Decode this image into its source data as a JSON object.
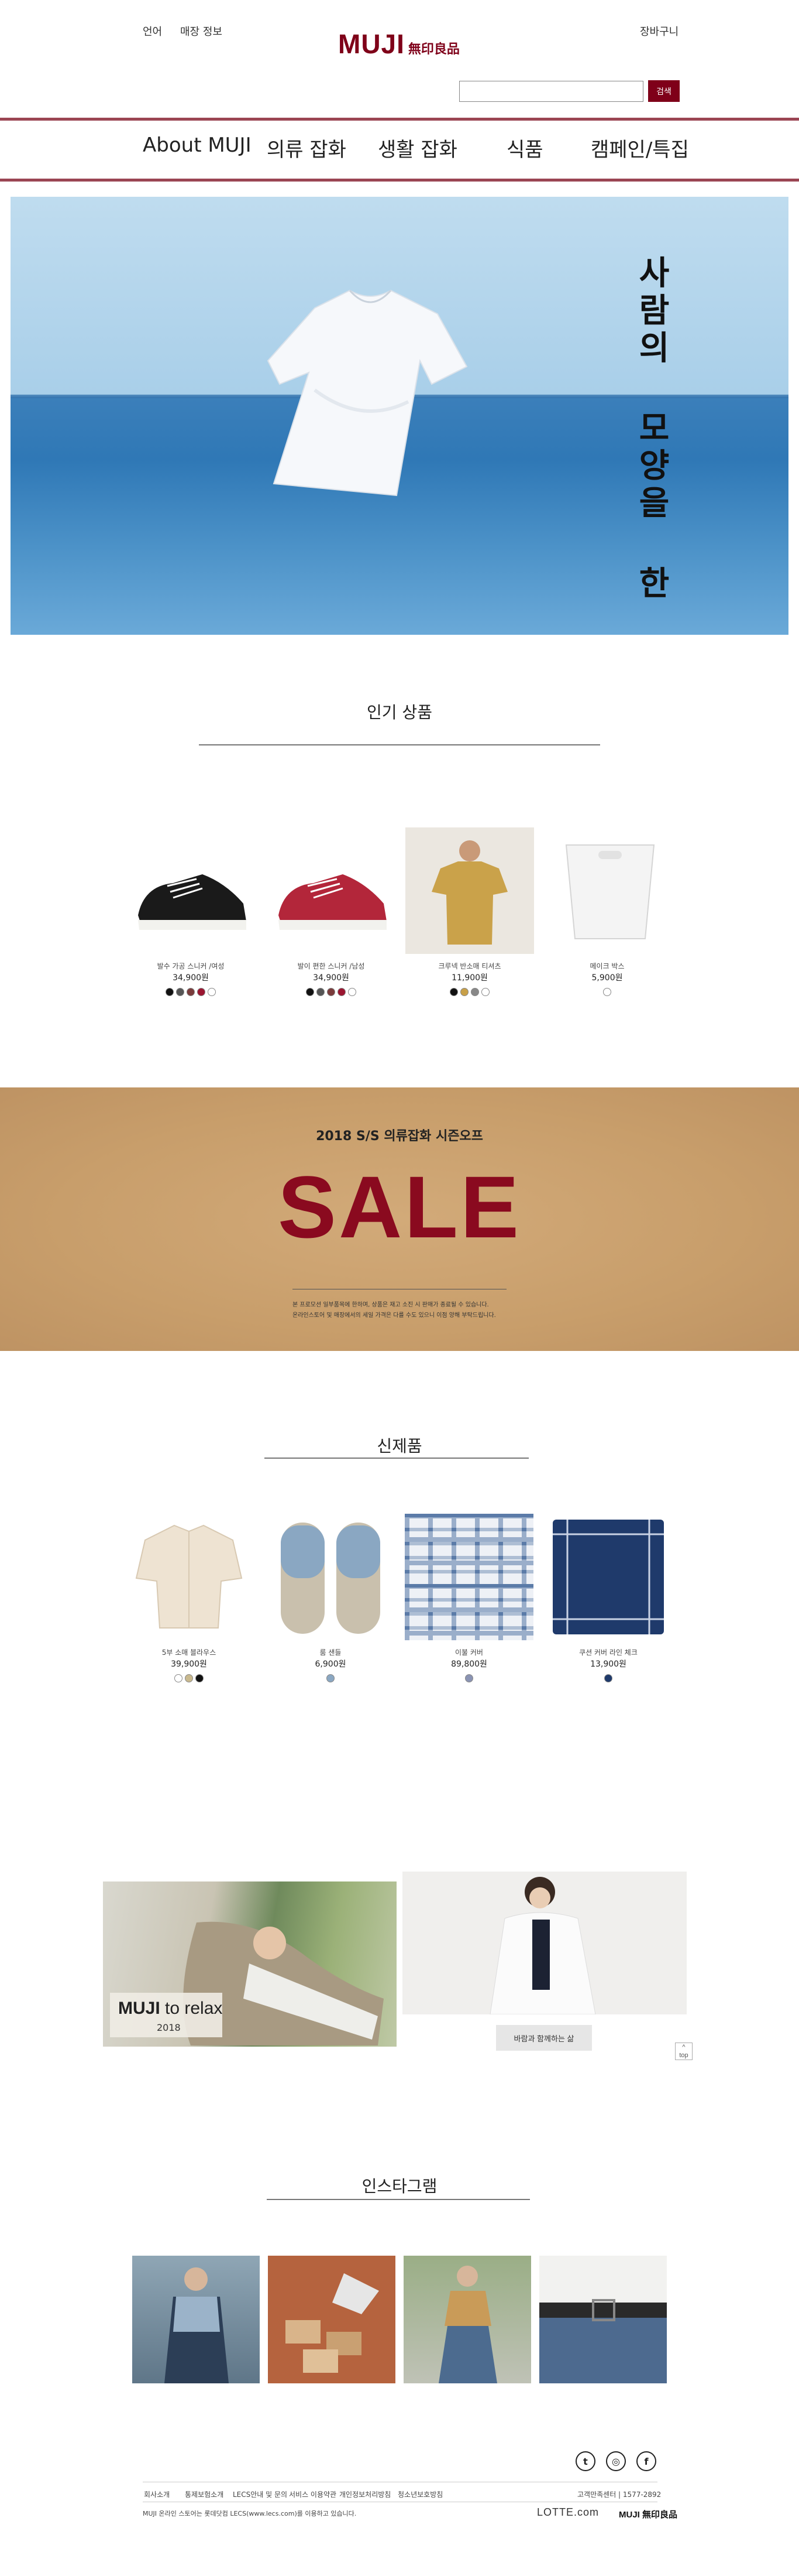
{
  "header": {
    "language": "언어",
    "store_info": "매장 정보",
    "cart": "장바구니",
    "logo_en": "MUJI",
    "logo_jp": "無印良品",
    "search_placeholder": "",
    "search_button": "검색",
    "accent_color": "#7f0019"
  },
  "nav": [
    "About MUJI",
    "의류 잡화",
    "생활 잡화",
    "식품",
    "캠페인/특집"
  ],
  "hero": {
    "title": "사람의 모양을 한 면"
  },
  "popular": {
    "title": "인기 상품",
    "items": [
      {
        "name": "발수 가공 스니커 /여성",
        "price": "34,900원",
        "colors": [
          "#111111",
          "#555555",
          "#7a3b3b",
          "#9b1530",
          "#ffffff"
        ],
        "image": "black-sneaker"
      },
      {
        "name": "발이 편한 스니커 /남성",
        "price": "34,900원",
        "colors": [
          "#111111",
          "#555555",
          "#7a3b3b",
          "#9b1530",
          "#ffffff"
        ],
        "image": "red-sneaker"
      },
      {
        "name": "크루넥 반소매 티셔츠",
        "price": "11,900원",
        "colors": [
          "#111111",
          "#c8a048",
          "#888888",
          "#ffffff"
        ],
        "image": "mustard-tshirt"
      },
      {
        "name": "메이크 박스",
        "price": "5,900원",
        "colors": [
          "#ffffff"
        ],
        "image": "white-box"
      }
    ]
  },
  "sale": {
    "subtitle": "2018 S/S 의류잡화 시즌오프",
    "big": "SALE",
    "note1": "본 프로모션 일부품목에 한하며, 상품은 재고 소진 시 판매가 종료될 수 있습니다.",
    "note2": "온라인스토어 및 매장에서의 세일 가격은 다를 수도 있으니 이점 양해 부탁드립니다."
  },
  "new_items": {
    "title": "신제품",
    "items": [
      {
        "name": "5부 소매 블라우스",
        "price": "39,900원",
        "colors": [
          "#ffffff",
          "#c9b98e",
          "#111111"
        ],
        "image": "blouse"
      },
      {
        "name": "룸 샌들",
        "price": "6,900원",
        "colors": [
          "#8aa7c2"
        ],
        "image": "sandals"
      },
      {
        "name": "이불 커버",
        "price": "89,800원",
        "colors": [
          "#8a93b3"
        ],
        "image": "check-cover"
      },
      {
        "name": "쿠션 커버 라인 체크",
        "price": "13,900원",
        "colors": [
          "#1f3a6b"
        ],
        "image": "navy-cushion"
      }
    ]
  },
  "banners": {
    "relax_title_bold": "MUJI",
    "relax_title_rest": " to relax",
    "relax_year": "2018",
    "life_button": "바람과 함께하는 삶",
    "top_button": "top"
  },
  "instagram": {
    "title": "인스타그램"
  },
  "footer": {
    "social": [
      "twitter-icon",
      "instagram-icon",
      "facebook-icon"
    ],
    "social_glyphs": [
      "t",
      "◎",
      "f"
    ],
    "links": [
      "회사소개",
      "통제보험소개",
      "LECS안내 및 문의",
      "서비스 이용약관",
      "개인정보처리방침",
      "청소년보호방침"
    ],
    "customer_center": "고객만족센터 | 1577-2892",
    "copyright": "MUJI 온라인 스토어는 롯데닷컴 LECS(www.lecs.com)를 이용하고 있습니다.",
    "lotte": "LOTTE.com",
    "muji_small": "MUJI 無印良品"
  }
}
